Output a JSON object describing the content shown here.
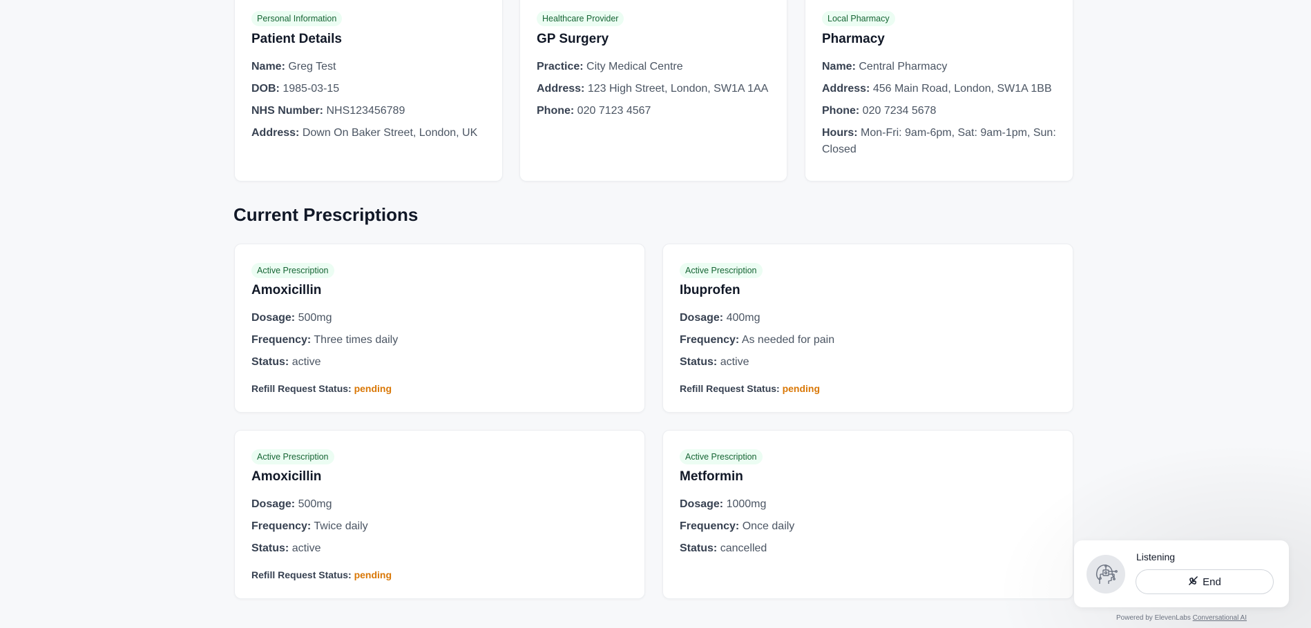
{
  "info_cards": {
    "patient": {
      "badge": "Personal Information",
      "title": "Patient Details",
      "rows": [
        {
          "label": "Name:",
          "value": "Greg Test"
        },
        {
          "label": "DOB:",
          "value": "1985-03-15"
        },
        {
          "label": "NHS Number:",
          "value": "NHS123456789"
        },
        {
          "label": "Address:",
          "value": "Down On Baker Street, London, UK"
        }
      ]
    },
    "gp": {
      "badge": "Healthcare Provider",
      "title": "GP Surgery",
      "rows": [
        {
          "label": "Practice:",
          "value": "City Medical Centre"
        },
        {
          "label": "Address:",
          "value": "123 High Street, London, SW1A 1AA"
        },
        {
          "label": "Phone:",
          "value": "020 7123 4567"
        }
      ]
    },
    "pharmacy": {
      "badge": "Local Pharmacy",
      "title": "Pharmacy",
      "rows": [
        {
          "label": "Name:",
          "value": "Central Pharmacy"
        },
        {
          "label": "Address:",
          "value": "456 Main Road, London, SW1A 1BB"
        },
        {
          "label": "Phone:",
          "value": "020 7234 5678"
        },
        {
          "label": "Hours:",
          "value": "Mon-Fri: 9am-6pm, Sat: 9am-1pm, Sun: Closed"
        }
      ]
    }
  },
  "section_title": "Current Prescriptions",
  "prescriptions": [
    {
      "badge": "Active Prescription",
      "name": "Amoxicillin",
      "dosage_label": "Dosage:",
      "dosage": "500mg",
      "frequency_label": "Frequency:",
      "frequency": "Three times daily",
      "status_label": "Status:",
      "status": "active",
      "refill_label": "Refill Request Status:",
      "refill": "pending"
    },
    {
      "badge": "Active Prescription",
      "name": "Ibuprofen",
      "dosage_label": "Dosage:",
      "dosage": "400mg",
      "frequency_label": "Frequency:",
      "frequency": "As needed for pain",
      "status_label": "Status:",
      "status": "active",
      "refill_label": "Refill Request Status:",
      "refill": "pending"
    },
    {
      "badge": "Active Prescription",
      "name": "Amoxicillin",
      "dosage_label": "Dosage:",
      "dosage": "500mg",
      "frequency_label": "Frequency:",
      "frequency": "Twice daily",
      "status_label": "Status:",
      "status": "active",
      "refill_label": "Refill Request Status:",
      "refill": "pending"
    },
    {
      "badge": "Active Prescription",
      "name": "Metformin",
      "dosage_label": "Dosage:",
      "dosage": "1000mg",
      "frequency_label": "Frequency:",
      "frequency": "Once daily",
      "status_label": "Status:",
      "status": "cancelled"
    }
  ],
  "widget": {
    "status": "Listening",
    "end_label": "End",
    "avatar_icon": "robot-face-icon",
    "end_icon": "phone-hangup-icon",
    "powered_prefix": "Powered by ElevenLabs",
    "powered_link": "Conversational AI"
  },
  "colors": {
    "badge_bg": "#ecfdf3",
    "badge_text": "#166534",
    "pending": "#d97706"
  }
}
